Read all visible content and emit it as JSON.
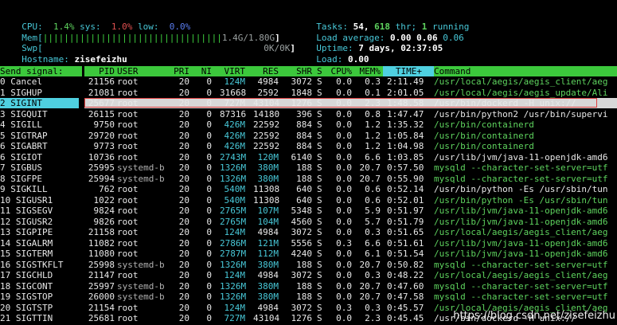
{
  "meters": {
    "cpu_label": "CPU:",
    "cpu_user": "1.4%",
    "cpu_sys_label": "sys:",
    "cpu_sys": "1.0%",
    "cpu_low_label": "low:",
    "cpu_low": "0.0%",
    "mem_label": "Mem[",
    "mem_bar": "||||||||||||||||||||||||||||||||||",
    "mem_value": "1.4G/1.80G",
    "mem_close": "]",
    "swp_label": "Swp[",
    "swp_value": "0K/0K",
    "swp_close": "]",
    "hostname_label": "Hostname:",
    "hostname": "zisefeizhu"
  },
  "stats": {
    "tasks_label": "Tasks:",
    "tasks": "54,",
    "thr": "618",
    "thr_label": "thr;",
    "running": "1",
    "running_label": "running",
    "load_label": "Load average:",
    "load1": "0.00",
    "load5": "0.06",
    "load15": "0.06",
    "uptime_label": "Uptime:",
    "uptime": "7 days, 02:37:05",
    "load_single_label": "Load:",
    "load_single": "0.00"
  },
  "signal_header": "Send signal:",
  "columns": {
    "pid": "PID",
    "user": "USER",
    "pri": "PRI",
    "ni": "NI",
    "virt": "VIRT",
    "res": "RES",
    "shr": "SHR",
    "s": "S",
    "cpu": "CPU%",
    "mem": "MEM%",
    "time": "TIME+",
    "command": "Command"
  },
  "signals": [
    "0 Cancel",
    "1 SIGHUP",
    "2 SIGINT",
    "3 SIGQUIT",
    "4 SIGILL",
    "5 SIGTRAP",
    "6 SIGABRT",
    "6 SIGIOT",
    "7 SIGBUS",
    "8 SIGFPE",
    "9 SIGKILL",
    "10 SIGUSR1",
    "11 SIGSEGV",
    "12 SIGUSR2",
    "13 SIGPIPE",
    "14 SIGALRM",
    "15 SIGTERM",
    "16 SIGSTKFLT",
    "17 SIGCHLD",
    "18 SIGCONT",
    "19 SIGSTOP",
    "20 SIGTSTP",
    "21 SIGTTIN"
  ],
  "selected_index": 2,
  "processes": [
    {
      "pid": "21156",
      "user": "root",
      "pri": "20",
      "ni": "0",
      "virt": "124M",
      "res": "4984",
      "shr": "3072",
      "s": "S",
      "cpu": "0.0",
      "mem": "0.3",
      "time": "2:11.49",
      "cmd": "/usr/local/aegis/aegis_client/aeg"
    },
    {
      "pid": "21081",
      "user": "root",
      "pri": "20",
      "ni": "0",
      "virt": "31668",
      "res": "2592",
      "shr": "1848",
      "s": "S",
      "cpu": "0.0",
      "mem": "0.1",
      "time": "2:01.05",
      "cmd": "/usr/local/aegis/aegis_update/Ali"
    },
    {
      "pid": "25677",
      "user": "root",
      "pri": "20",
      "ni": "0",
      "virt": "727M",
      "res": "43104",
      "shr": "1276",
      "s": "S",
      "cpu": "0.0",
      "mem": "2.3",
      "time": "1:48.58",
      "cmd": "/usr/bin/dockerd -H unix://"
    },
    {
      "pid": "26115",
      "user": "root",
      "pri": "20",
      "ni": "0",
      "virt": "87316",
      "res": "14180",
      "shr": "396",
      "s": "S",
      "cpu": "0.0",
      "mem": "0.8",
      "time": "1:47.47",
      "cmd": "/usr/bin/python2 /usr/bin/supervi"
    },
    {
      "pid": "9750",
      "user": "root",
      "pri": "20",
      "ni": "0",
      "virt": "426M",
      "res": "22592",
      "shr": "884",
      "s": "S",
      "cpu": "0.0",
      "mem": "1.2",
      "time": "1:35.32",
      "cmd": "/usr/bin/containerd"
    },
    {
      "pid": "29720",
      "user": "root",
      "pri": "20",
      "ni": "0",
      "virt": "426M",
      "res": "22592",
      "shr": "884",
      "s": "S",
      "cpu": "0.0",
      "mem": "1.2",
      "time": "1:05.84",
      "cmd": "/usr/bin/containerd"
    },
    {
      "pid": "9773",
      "user": "root",
      "pri": "20",
      "ni": "0",
      "virt": "426M",
      "res": "22592",
      "shr": "884",
      "s": "S",
      "cpu": "0.0",
      "mem": "1.2",
      "time": "1:04.98",
      "cmd": "/usr/bin/containerd"
    },
    {
      "pid": "10736",
      "user": "root",
      "pri": "20",
      "ni": "0",
      "virt": "2743M",
      "res": "120M",
      "shr": "6140",
      "s": "S",
      "cpu": "0.0",
      "mem": "6.6",
      "time": "1:03.85",
      "cmd": "/usr/lib/jvm/java-11-openjdk-amd6"
    },
    {
      "pid": "25995",
      "user": "systemd-b",
      "pri": "20",
      "ni": "0",
      "virt": "1326M",
      "res": "380M",
      "shr": "188",
      "s": "S",
      "cpu": "0.0",
      "mem": "20.7",
      "time": "0:57.50",
      "cmd": "mysqld --character-set-server=utf"
    },
    {
      "pid": "25994",
      "user": "systemd-b",
      "pri": "20",
      "ni": "0",
      "virt": "1326M",
      "res": "380M",
      "shr": "188",
      "s": "S",
      "cpu": "0.0",
      "mem": "20.7",
      "time": "0:55.90",
      "cmd": "mysqld --character-set-server=utf"
    },
    {
      "pid": "762",
      "user": "root",
      "pri": "20",
      "ni": "0",
      "virt": "540M",
      "res": "11308",
      "shr": "640",
      "s": "S",
      "cpu": "0.0",
      "mem": "0.6",
      "time": "0:52.14",
      "cmd": "/usr/bin/python -Es /usr/sbin/tun"
    },
    {
      "pid": "1022",
      "user": "root",
      "pri": "20",
      "ni": "0",
      "virt": "540M",
      "res": "11308",
      "shr": "640",
      "s": "S",
      "cpu": "0.0",
      "mem": "0.6",
      "time": "0:52.01",
      "cmd": "/usr/bin/python -Es /usr/sbin/tun"
    },
    {
      "pid": "9824",
      "user": "root",
      "pri": "20",
      "ni": "0",
      "virt": "2765M",
      "res": "107M",
      "shr": "5348",
      "s": "S",
      "cpu": "0.0",
      "mem": "5.9",
      "time": "0:51.97",
      "cmd": "/usr/lib/jvm/java-11-openjdk-amd6"
    },
    {
      "pid": "9826",
      "user": "root",
      "pri": "20",
      "ni": "0",
      "virt": "2765M",
      "res": "104M",
      "shr": "4560",
      "s": "S",
      "cpu": "0.0",
      "mem": "5.7",
      "time": "0:51.79",
      "cmd": "/usr/lib/jvm/java-11-openjdk-amd6"
    },
    {
      "pid": "21158",
      "user": "root",
      "pri": "20",
      "ni": "0",
      "virt": "124M",
      "res": "4984",
      "shr": "3072",
      "s": "S",
      "cpu": "0.0",
      "mem": "0.3",
      "time": "0:51.65",
      "cmd": "/usr/local/aegis/aegis_client/aeg"
    },
    {
      "pid": "11082",
      "user": "root",
      "pri": "20",
      "ni": "0",
      "virt": "2786M",
      "res": "121M",
      "shr": "5556",
      "s": "S",
      "cpu": "0.3",
      "mem": "6.6",
      "time": "0:51.61",
      "cmd": "/usr/lib/jvm/java-11-openjdk-amd6"
    },
    {
      "pid": "11080",
      "user": "root",
      "pri": "20",
      "ni": "0",
      "virt": "2787M",
      "res": "112M",
      "shr": "4240",
      "s": "S",
      "cpu": "0.0",
      "mem": "6.1",
      "time": "0:51.54",
      "cmd": "/usr/lib/jvm/java-11-openjdk-amd6"
    },
    {
      "pid": "25998",
      "user": "systemd-b",
      "pri": "20",
      "ni": "0",
      "virt": "1326M",
      "res": "380M",
      "shr": "188",
      "s": "S",
      "cpu": "0.0",
      "mem": "20.7",
      "time": "0:50.82",
      "cmd": "mysqld --character-set-server=utf"
    },
    {
      "pid": "21147",
      "user": "root",
      "pri": "20",
      "ni": "0",
      "virt": "124M",
      "res": "4984",
      "shr": "3072",
      "s": "S",
      "cpu": "0.0",
      "mem": "0.3",
      "time": "0:48.22",
      "cmd": "/usr/local/aegis/aegis_client/aeg"
    },
    {
      "pid": "25997",
      "user": "systemd-b",
      "pri": "20",
      "ni": "0",
      "virt": "1326M",
      "res": "380M",
      "shr": "188",
      "s": "S",
      "cpu": "0.0",
      "mem": "20.7",
      "time": "0:47.60",
      "cmd": "mysqld --character-set-server=utf"
    },
    {
      "pid": "26000",
      "user": "systemd-b",
      "pri": "20",
      "ni": "0",
      "virt": "1326M",
      "res": "380M",
      "shr": "188",
      "s": "S",
      "cpu": "0.0",
      "mem": "20.7",
      "time": "0:47.58",
      "cmd": "mysqld --character-set-server=utf"
    },
    {
      "pid": "21154",
      "user": "root",
      "pri": "20",
      "ni": "0",
      "virt": "124M",
      "res": "4984",
      "shr": "3072",
      "s": "S",
      "cpu": "0.3",
      "mem": "0.3",
      "time": "0:45.57",
      "cmd": "/usr/local/aegis/aegis_client/aeg"
    },
    {
      "pid": "25681",
      "user": "root",
      "pri": "20",
      "ni": "0",
      "virt": "727M",
      "res": "43104",
      "shr": "1276",
      "s": "S",
      "cpu": "0.0",
      "mem": "2.3",
      "time": "0:45.45",
      "cmd": "/usr/bin/dockerd -H unix://"
    }
  ],
  "watermark": "https://blog.csdn.net/zisefeizhu"
}
